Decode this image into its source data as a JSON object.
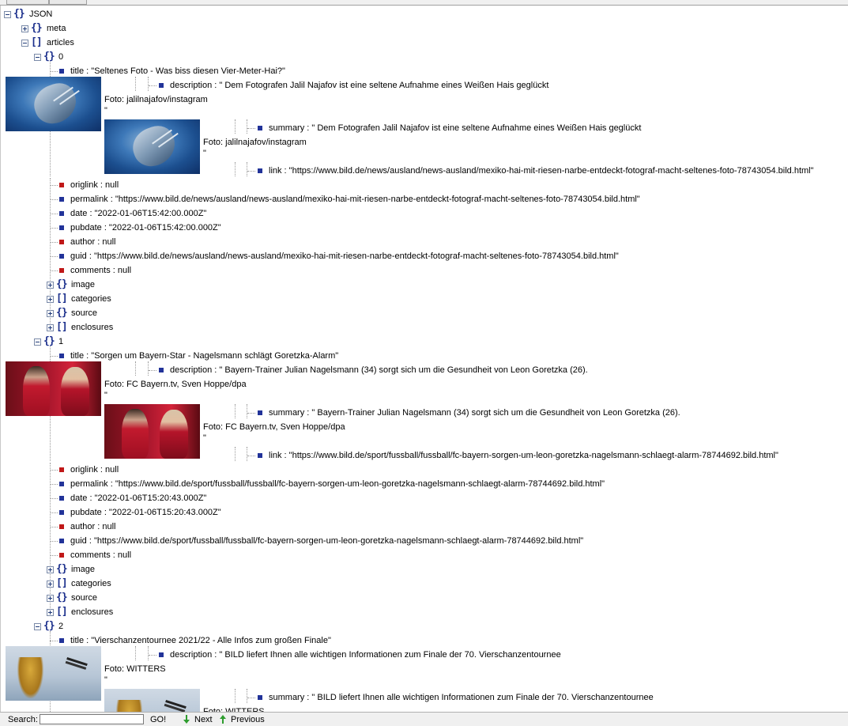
{
  "tree": {
    "root": "JSON",
    "meta": "meta",
    "articles": "articles",
    "items": [
      {
        "index": "0",
        "title": "title : \"Seltenes Foto - Was biss diesen Vier-Meter-Hai?\"",
        "description": "description : \" Dem Fotografen Jalil Najafov ist eine seltene Aufnahme eines Weißen Hais geglückt",
        "description_credit": "Foto: jalilnajafov/instagram",
        "summary": "summary : \" Dem Fotografen Jalil Najafov ist eine seltene Aufnahme eines Weißen Hais geglückt",
        "summary_credit": "Foto: jalilnajafov/instagram",
        "link": "link : \"https://www.bild.de/news/ausland/news-ausland/mexiko-hai-mit-riesen-narbe-entdeckt-fotograf-macht-seltenes-foto-78743054.bild.html\"",
        "origlink": "origlink : null",
        "permalink": "permalink : \"https://www.bild.de/news/ausland/news-ausland/mexiko-hai-mit-riesen-narbe-entdeckt-fotograf-macht-seltenes-foto-78743054.bild.html\"",
        "date": "date : \"2022-01-06T15:42:00.000Z\"",
        "pubdate": "pubdate : \"2022-01-06T15:42:00.000Z\"",
        "author": "author : null",
        "guid": "guid : \"https://www.bild.de/news/ausland/news-ausland/mexiko-hai-mit-riesen-narbe-entdeckt-fotograf-macht-seltenes-foto-78743054.bild.html\"",
        "comments": "comments : null",
        "image": "image",
        "categories": "categories",
        "source": "source",
        "enclosures": "enclosures"
      },
      {
        "index": "1",
        "title": "title : \"Sorgen um Bayern-Star - Nagelsmann schlägt Goretzka-Alarm\"",
        "description": "description : \" Bayern-Trainer Julian Nagelsmann (34) sorgt sich um die Gesundheit von Leon Goretzka (26).",
        "description_credit": "Foto: FC Bayern.tv, Sven Hoppe/dpa",
        "summary": "summary : \" Bayern-Trainer Julian Nagelsmann (34) sorgt sich um die Gesundheit von Leon Goretzka (26).",
        "summary_credit": "Foto: FC Bayern.tv, Sven Hoppe/dpa",
        "link": "link : \"https://www.bild.de/sport/fussball/fussball/fc-bayern-sorgen-um-leon-goretzka-nagelsmann-schlaegt-alarm-78744692.bild.html\"",
        "origlink": "origlink : null",
        "permalink": "permalink : \"https://www.bild.de/sport/fussball/fussball/fc-bayern-sorgen-um-leon-goretzka-nagelsmann-schlaegt-alarm-78744692.bild.html\"",
        "date": "date : \"2022-01-06T15:20:43.000Z\"",
        "pubdate": "pubdate : \"2022-01-06T15:20:43.000Z\"",
        "author": "author : null",
        "guid": "guid : \"https://www.bild.de/sport/fussball/fussball/fc-bayern-sorgen-um-leon-goretzka-nagelsmann-schlaegt-alarm-78744692.bild.html\"",
        "comments": "comments : null",
        "image": "image",
        "categories": "categories",
        "source": "source",
        "enclosures": "enclosures"
      },
      {
        "index": "2",
        "title": "title : \"Vierschanzentournee 2021/22 - Alle Infos zum großen Finale\"",
        "description": "description : \" BILD liefert Ihnen alle wichtigen Informationen zum Finale der 70. Vierschanzentournee",
        "description_credit": "Foto: WITTERS",
        "summary": "summary : \" BILD liefert Ihnen alle wichtigen Informationen zum Finale der 70. Vierschanzentournee",
        "summary_credit": "Foto: WITTERS"
      }
    ],
    "quote_mark": "\""
  },
  "statusbar": {
    "search_label": "Search:",
    "search_value": "",
    "go_label": "GO!",
    "next_label": "Next",
    "previous_label": "Previous"
  },
  "colors": {
    "object_brace": "#1b2f8c",
    "value_marker": "#223399",
    "null_marker": "#c01818",
    "next_arrow": "#2e9d2e"
  }
}
